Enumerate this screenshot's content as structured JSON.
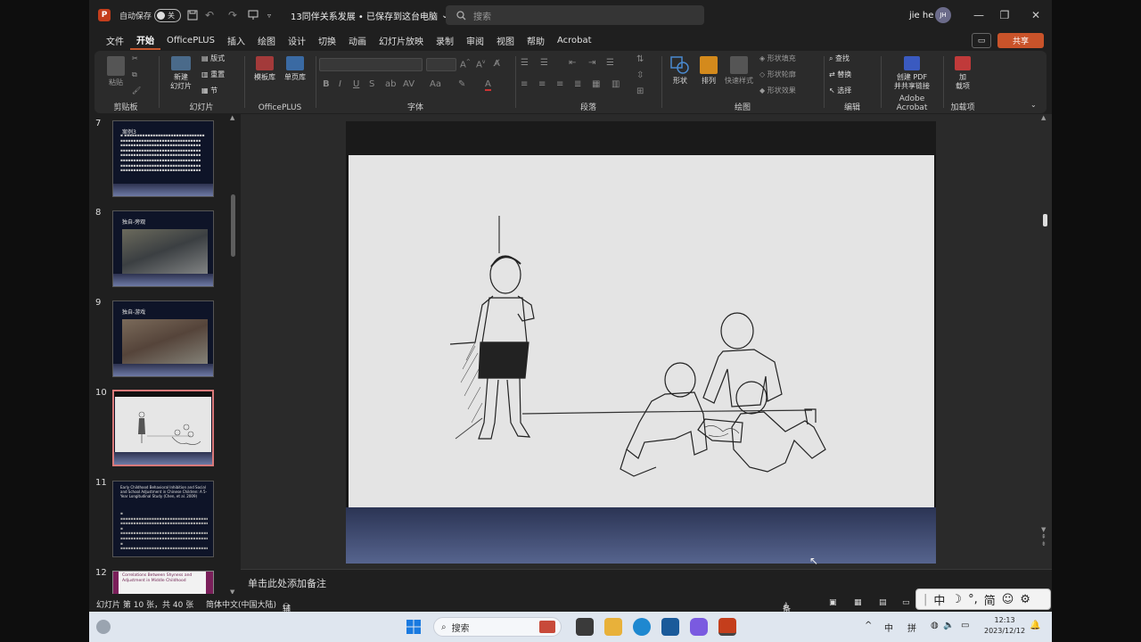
{
  "titlebar": {
    "autosave_label": "自动保存",
    "autosave_state": "关",
    "doc_title": "13同伴关系发展 • 已保存到这台电脑",
    "search_placeholder": "搜索",
    "user_name": "jie he",
    "user_initials": "JH"
  },
  "menu": {
    "tabs": [
      "文件",
      "开始",
      "OfficePLUS",
      "插入",
      "绘图",
      "设计",
      "切换",
      "动画",
      "幻灯片放映",
      "录制",
      "审阅",
      "视图",
      "帮助",
      "Acrobat"
    ],
    "active_tab": "开始",
    "share_label": "共享"
  },
  "ribbon": {
    "clipboard": {
      "paste": "粘贴",
      "label": "剪贴板"
    },
    "slides": {
      "new_slide": "新建",
      "new_slide2": "幻灯片",
      "layout": "版式",
      "reset": "重置",
      "section": "节",
      "label": "幻灯片"
    },
    "officeplus": {
      "template": "模板库",
      "single": "单页库",
      "label": "OfficePLUS"
    },
    "font": {
      "label": "字体"
    },
    "paragraph": {
      "label": "段落"
    },
    "drawing": {
      "shapes": "形状",
      "arrange": "排列",
      "quick_styles": "快速样式",
      "fill": "形状填充",
      "outline": "形状轮廓",
      "effects": "形状效果",
      "label": "绘图"
    },
    "editing": {
      "find": "查找",
      "replace": "替换",
      "select": "选择",
      "label": "编辑"
    },
    "acrobat": {
      "create": "创建 PDF",
      "create2": "并共享链接",
      "label": "Adobe Acrobat"
    },
    "addins": {
      "add": "加",
      "add2": "载项",
      "label": "加载项"
    }
  },
  "thumbnails": [
    {
      "num": "7",
      "title": "案例3"
    },
    {
      "num": "8",
      "title": "独自-旁观"
    },
    {
      "num": "9",
      "title": "独自-游戏"
    },
    {
      "num": "10",
      "title": ""
    },
    {
      "num": "11",
      "title": "Early Childhood Behavioral Inhibition and Social and School Adjustment in Chinese Children: A 5-Year Longitudinal Study (Chen, et al. 2009)"
    },
    {
      "num": "12",
      "title": "Correlations Between Shyness and Adjustment in Middle Childhood"
    }
  ],
  "notes_placeholder": "单击此处添加备注",
  "status": {
    "slide_info": "幻灯片 第 10 张，共 40 张",
    "language": "简体中文(中国大陆)",
    "accessibility": "辅助功能: 调查",
    "notes_btn": "备注"
  },
  "taskbar": {
    "search": "搜索",
    "ime_zh": "中",
    "ime_pinyin": "拼",
    "time": "12:13",
    "date": "2023/12/12"
  },
  "ime_bar": [
    "中",
    "简"
  ]
}
